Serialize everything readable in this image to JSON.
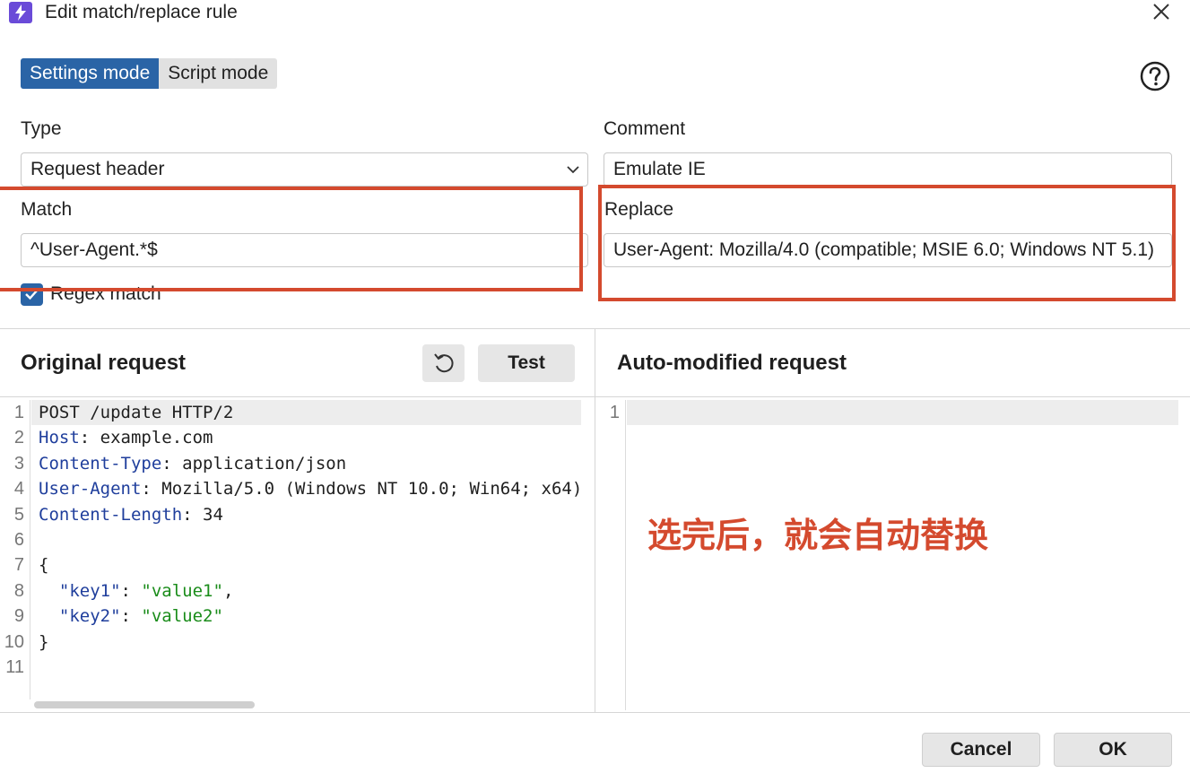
{
  "window": {
    "title": "Edit match/replace rule"
  },
  "modes": [
    {
      "label": "Settings mode",
      "active": true
    },
    {
      "label": "Script mode",
      "active": false
    }
  ],
  "form": {
    "type_label": "Type",
    "type_value": "Request header",
    "comment_label": "Comment",
    "comment_value": "Emulate IE",
    "match_label": "Match",
    "match_value": "^User-Agent.*$",
    "replace_label": "Replace",
    "replace_value": "User-Agent: Mozilla/4.0 (compatible; MSIE 6.0; Windows NT 5.1)",
    "regex_label": "Regex match",
    "regex_checked": true
  },
  "original": {
    "title": "Original request",
    "test_label": "Test",
    "line_numbers": [
      "1",
      "2",
      "3",
      "4",
      "5",
      "6",
      "7",
      "8",
      "9",
      "10",
      "11"
    ]
  },
  "modified": {
    "title": "Auto-modified request",
    "line_numbers": [
      "1"
    ]
  },
  "annotation": "选完后，就会自动替换",
  "footer": {
    "cancel_label": "Cancel",
    "ok_label": "OK"
  },
  "colors": {
    "accent": "#2a64a6",
    "highlight": "#d44a2e",
    "header_key": "#1f3e9c",
    "string": "#1a8c1a"
  }
}
